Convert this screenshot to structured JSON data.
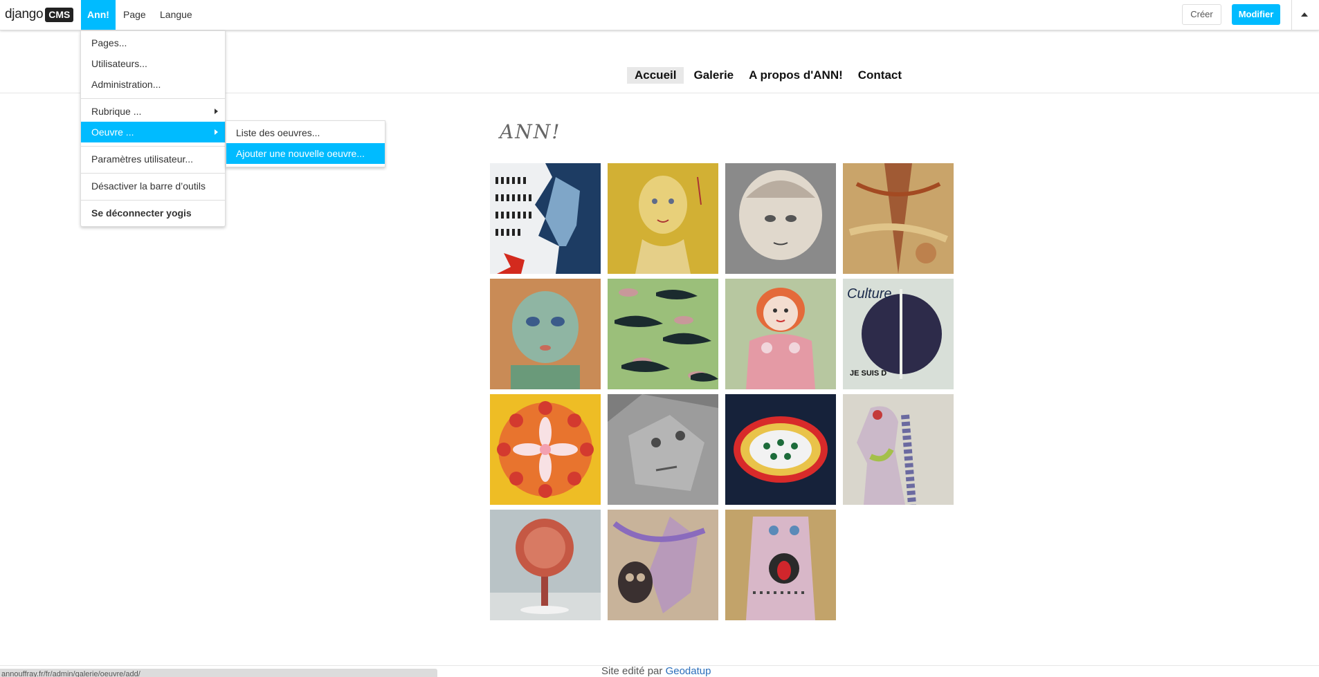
{
  "toolbar": {
    "logo_text": "django",
    "logo_badge": "CMS",
    "menu_ann": "Ann!",
    "menu_page": "Page",
    "menu_langue": "Langue",
    "creer_label": "Créer",
    "modifier_label": "Modifier",
    "accent_color": "#00bbff"
  },
  "ann_menu": {
    "items": [
      {
        "label": "Pages..."
      },
      {
        "label": "Utilisateurs..."
      },
      {
        "label": "Administration..."
      },
      {
        "label": "Rubrique ..."
      },
      {
        "label": "Oeuvre ..."
      },
      {
        "label": "Paramètres utilisateur..."
      },
      {
        "label": "Désactiver la barre d’outils"
      },
      {
        "label": "Se déconnecter yogis"
      }
    ]
  },
  "oeuvre_submenu": {
    "items": [
      {
        "label": "Liste des oeuvres..."
      },
      {
        "label": "Ajouter une nouvelle oeuvre..."
      }
    ]
  },
  "site_nav": {
    "items": [
      {
        "label": "Accueil"
      },
      {
        "label": "Galerie"
      },
      {
        "label": "A propos d'ANN!"
      },
      {
        "label": "Contact"
      }
    ]
  },
  "signature": "ANN!",
  "gallery": {
    "thumbnails": [
      {
        "name": "artwork-blue-profile"
      },
      {
        "name": "artwork-yellow-figure"
      },
      {
        "name": "artwork-ceramic-head"
      },
      {
        "name": "artwork-abstract-amber"
      },
      {
        "name": "artwork-green-face"
      },
      {
        "name": "artwork-fish-school"
      },
      {
        "name": "artwork-red-hair-figure"
      },
      {
        "name": "artwork-culture-collage"
      },
      {
        "name": "artwork-flower-mandala"
      },
      {
        "name": "artwork-stone-face"
      },
      {
        "name": "artwork-painted-fish"
      },
      {
        "name": "artwork-profile-spine"
      },
      {
        "name": "artwork-red-tree"
      },
      {
        "name": "artwork-skull-figure"
      },
      {
        "name": "artwork-pink-figure-red-mouth"
      }
    ]
  },
  "footer": {
    "prefix": "Site edité par",
    "link_text": "Geodatup"
  },
  "statusbar_url": "annouffray.fr/fr/admin/galerie/oeuvre/add/"
}
